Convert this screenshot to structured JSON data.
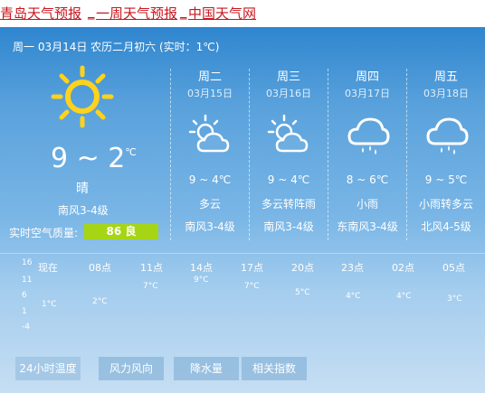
{
  "page": {
    "title_city": "青岛天气预报",
    "title_sep1": "_",
    "title_week": "一周天气预报",
    "title_sep2": "_",
    "title_site": "中国天气网"
  },
  "today": {
    "date_line": "周一 03月14日 农历二月初六 (实时：1℃)",
    "icon": "sun-icon",
    "temp": "9 ~ 2",
    "temp_unit": "℃",
    "condition": "晴",
    "wind": "南风3-4级",
    "aqi_label": "实时空气质量:",
    "aqi_value": "86 良",
    "aqi_color": "#a6d515"
  },
  "forecast": [
    {
      "day": "周二",
      "date": "03月15日",
      "icon": "partly-cloudy-sun-icon",
      "temp": "9 ~ 4℃",
      "condition": "多云",
      "wind": "南风3-4级"
    },
    {
      "day": "周三",
      "date": "03月16日",
      "icon": "partly-cloudy-sun-icon",
      "temp": "9 ~ 4℃",
      "condition": "多云转阵雨",
      "wind": "南风3-4级"
    },
    {
      "day": "周四",
      "date": "03月17日",
      "icon": "rain-cloud-icon",
      "temp": "8 ~ 6℃",
      "condition": "小雨",
      "wind": "东南风3-4级"
    },
    {
      "day": "周五",
      "date": "03月18日",
      "icon": "rain-cloud-icon",
      "temp": "9 ~ 5℃",
      "condition": "小雨转多云",
      "wind": "北风4-5级"
    }
  ],
  "hourly": {
    "y_ticks": [
      "16",
      "11",
      "6",
      "1",
      "-4"
    ],
    "labels": [
      "现在",
      "08点",
      "11点",
      "14点",
      "17点",
      "20点",
      "23点",
      "02点",
      "05点"
    ],
    "temps": [
      "1°C",
      "2°C",
      "7°C",
      "9°C",
      "7°C",
      "5°C",
      "4°C",
      "4°C",
      "3°C"
    ]
  },
  "tabs": [
    "24小时温度",
    "风力风向",
    "降水量",
    "相关指数"
  ],
  "colors": {
    "title_red": "#c8161d",
    "panel_top": "#2f86cf",
    "panel_bottom": "#c6def3"
  }
}
